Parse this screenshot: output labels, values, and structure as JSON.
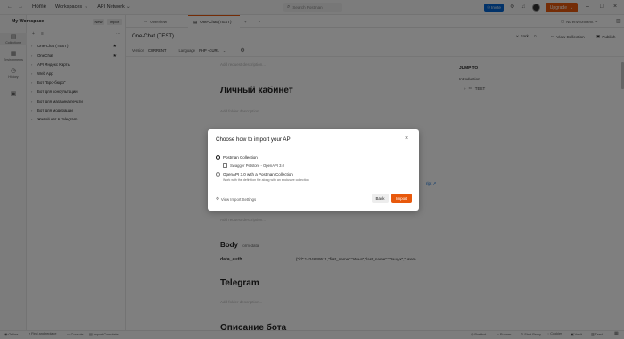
{
  "titlebar": {
    "home": "Home",
    "workspaces": "Workspaces",
    "api_network": "API Network",
    "search_placeholder": "Search Postman",
    "invite": "Invite",
    "upgrade": "Upgrade"
  },
  "rail": {
    "items": [
      {
        "label": "Collections",
        "icon": "collections-icon"
      },
      {
        "label": "Environments",
        "icon": "environments-icon"
      },
      {
        "label": "History",
        "icon": "history-icon"
      },
      {
        "label": "",
        "icon": "apps-icon"
      }
    ]
  },
  "sidebar": {
    "workspace_title": "My Workspace",
    "new_label": "New",
    "import_label": "Import",
    "collections": [
      {
        "label": "One-Chat (TEST)",
        "starred": true
      },
      {
        "label": "OneChat",
        "starred": true
      },
      {
        "label": "API Яндекс Карты",
        "starred": false
      },
      {
        "label": "Web App",
        "starred": false
      },
      {
        "label": "Бот \"Бро-бюро\"",
        "starred": false
      },
      {
        "label": "Бот для консультации",
        "starred": false
      },
      {
        "label": "Бот для магазина печати",
        "starred": false
      },
      {
        "label": "Бот для модерации",
        "starred": false
      },
      {
        "label": "Живой чат в Telegram",
        "starred": false
      }
    ]
  },
  "tabs": [
    {
      "label": "Overview",
      "active": false
    },
    {
      "label": "One-Chat (TEST)",
      "active": true
    }
  ],
  "environment": "No environment",
  "doc": {
    "title": "One-Chat (TEST)",
    "fork_label": "Fork",
    "fork_count": "0",
    "view_collection": "View Collection",
    "publish": "Publish",
    "version_label": "Version",
    "version_value": "CURRENT",
    "language_label": "Language",
    "language_value": "PHP - cURL",
    "add_description_1": "Add request description...",
    "heading_cabinet": "Личный кабинет",
    "add_description_2": "Add folder description...",
    "add_description_3": "Add request description...",
    "body_label": "Body",
    "body_type": "form-data",
    "body_key": "data_auth",
    "body_value": "{\"id\":1424649511,\"first_name\":\"Илья\",\"last_name\":\"Лащук\",\"usern",
    "heading_telegram": "Telegram",
    "add_description_4": "Add folder description...",
    "heading_bot": "Описание бота",
    "side_link": "ript ↗"
  },
  "jump": {
    "title": "JUMP TO",
    "intro": "Introduction",
    "test": "TEST"
  },
  "modal": {
    "title": "Choose how to import your API",
    "option1": "Postman Collection",
    "option1_sub": "Swagger Petstore - OpenAPI 3.0",
    "option2": "OpenAPI 3.0 with a Postman Collection",
    "option2_desc": "Work with the definition file along with an exclusive collection",
    "view_settings": "View Import Settings",
    "back": "Back",
    "import": "Import"
  },
  "footer": {
    "left": [
      "Online",
      "Find and replace",
      "Console",
      "Import Complete"
    ],
    "right": [
      "Postbot",
      "Runner",
      "Start Proxy",
      "Cookies",
      "Vault",
      "Trash"
    ]
  },
  "colors": {
    "accent": "#e8590c",
    "invite_blue": "#0265d2"
  }
}
